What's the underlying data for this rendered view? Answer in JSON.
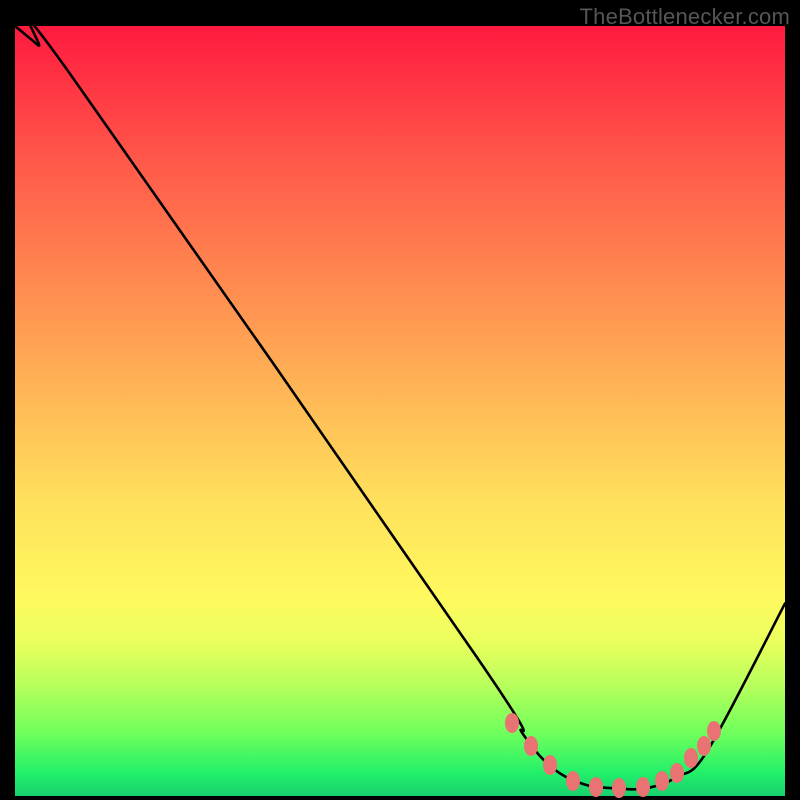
{
  "attribution": "TheBottlenecker.com",
  "chart_data": {
    "type": "line",
    "title": "",
    "xlabel": "",
    "ylabel": "",
    "xlim": [
      0,
      100
    ],
    "ylim": [
      0,
      100
    ],
    "series": [
      {
        "name": "bottleneck-curve",
        "x": [
          0,
          3,
          7,
          60,
          66,
          70,
          74,
          78,
          82,
          86,
          90,
          100
        ],
        "y": [
          100,
          97.5,
          94,
          18,
          8,
          3.5,
          1.5,
          1,
          1,
          2.5,
          6,
          25
        ]
      }
    ],
    "markers": {
      "name": "sweet-spot-beads",
      "color": "#e97272",
      "points": [
        {
          "x": 64.5,
          "y": 9.5
        },
        {
          "x": 67.0,
          "y": 6.5
        },
        {
          "x": 69.5,
          "y": 4.0
        },
        {
          "x": 72.5,
          "y": 2.0
        },
        {
          "x": 75.5,
          "y": 1.2
        },
        {
          "x": 78.5,
          "y": 1.0
        },
        {
          "x": 81.5,
          "y": 1.2
        },
        {
          "x": 84.0,
          "y": 2.0
        },
        {
          "x": 86.0,
          "y": 3.0
        },
        {
          "x": 87.8,
          "y": 5.0
        },
        {
          "x": 89.5,
          "y": 6.5
        },
        {
          "x": 90.8,
          "y": 8.5
        }
      ]
    },
    "background": {
      "type": "vertical-gradient",
      "stops": [
        {
          "pos": 0,
          "color": "#ff1a3f"
        },
        {
          "pos": 0.5,
          "color": "#ffc956"
        },
        {
          "pos": 0.8,
          "color": "#fff95f"
        },
        {
          "pos": 1,
          "color": "#17d06e"
        }
      ]
    }
  }
}
